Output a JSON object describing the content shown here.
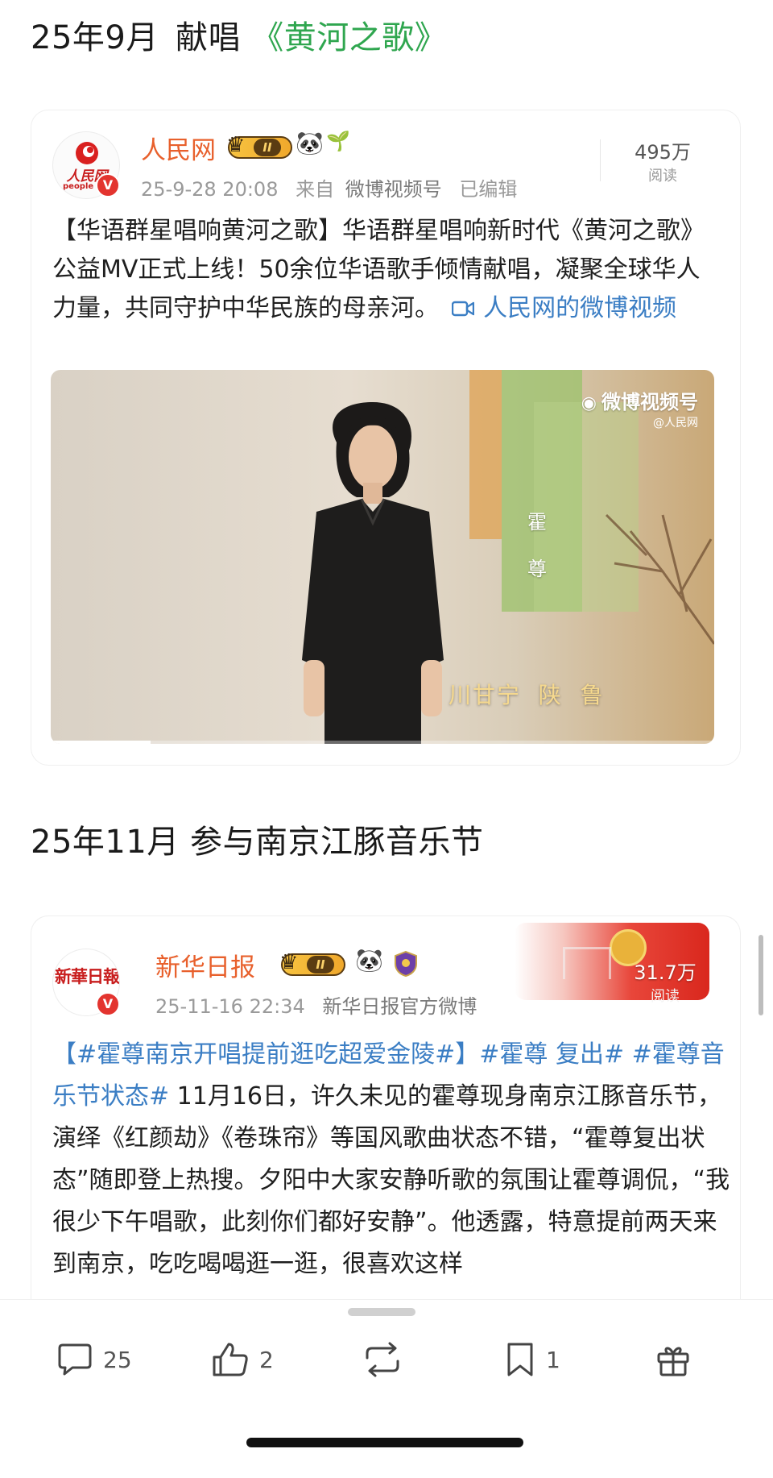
{
  "section1": {
    "date": "25年9月",
    "action": "献唱",
    "song": "《黄河之歌》"
  },
  "post1": {
    "author": "人民网",
    "avatar_text": "人民网",
    "avatar_sub": "people",
    "level": "II",
    "time": "25-9-28 20:08",
    "from_prefix": "来自",
    "source": "微博视频号",
    "edited": "已编辑",
    "reads_value": "495万",
    "reads_label": "阅读",
    "text_main": "【华语群星唱响黄河之歌】华语群星唱响新时代《黄河之歌》公益MV正式上线！50余位华语歌手倾情献唱，凝聚全球华人力量，共同守护中华民族的母亲河。",
    "link_text": "人民网的微博视频",
    "video": {
      "watermark": "微博视频号",
      "watermark_sub": "@人民网",
      "singer_line1": "霍",
      "singer_line2": "尊",
      "provinces": "川甘宁  陕  鲁",
      "progress_fraction": 0.15
    }
  },
  "section2": {
    "title": "25年11月 参与南京江豚音乐节"
  },
  "post2": {
    "author": "新华日报",
    "avatar_text": "新華日報",
    "level": "II",
    "time": "25-11-16 22:34",
    "source": "新华日报官方微博",
    "reads_value": "31.7万",
    "reads_label": "阅读",
    "topic1": "【#霍尊南京开唱提前逛吃超爱金陵#】",
    "topic2": "#霍尊 复出#",
    "topic3": "#霍尊音乐节状态#",
    "text": " 11月16日，许久未见的霍尊现身南京江豚音乐节，演绎《红颜劫》《卷珠帘》等国风歌曲状态不错，“霍尊复出状态”随即登上热搜。夕阳中大家安静听歌的氛围让霍尊调侃，“我很少下午唱歌，此刻你们都好安静”。他透露，特意提前两天来到南京，吃吃喝喝逛一逛，很喜欢这样"
  },
  "actions": {
    "comments": "25",
    "likes": "2",
    "favorites": "1"
  },
  "colors": {
    "highlight_green": "#2fa64f",
    "author_orange": "#e8602c",
    "link_blue": "#3b7ec4"
  }
}
